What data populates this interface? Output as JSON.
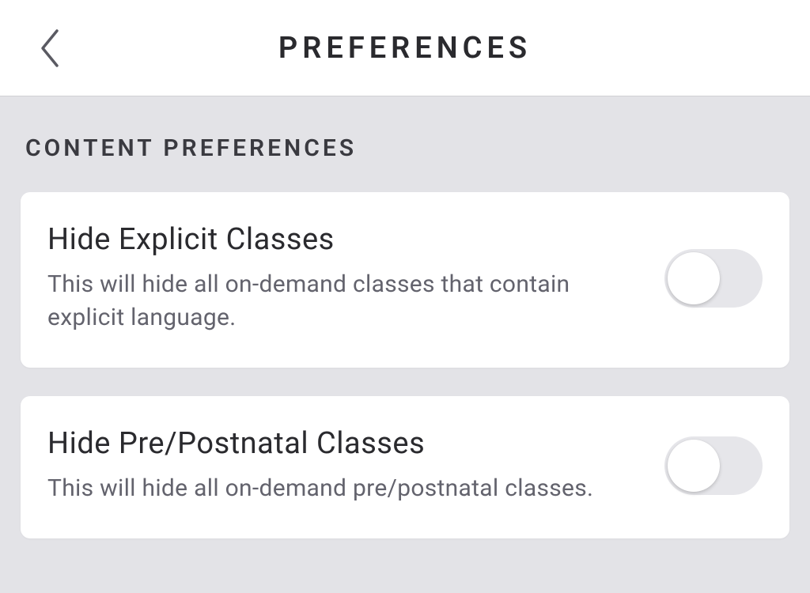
{
  "header": {
    "title": "PREFERENCES"
  },
  "section": {
    "title": "CONTENT PREFERENCES"
  },
  "settings": [
    {
      "title": "Hide Explicit Classes",
      "description": "This will hide all on-demand classes that contain explicit language.",
      "enabled": false
    },
    {
      "title": "Hide Pre/Postnatal Classes",
      "description": "This will hide all on-demand pre/postnatal classes.",
      "enabled": false
    }
  ]
}
